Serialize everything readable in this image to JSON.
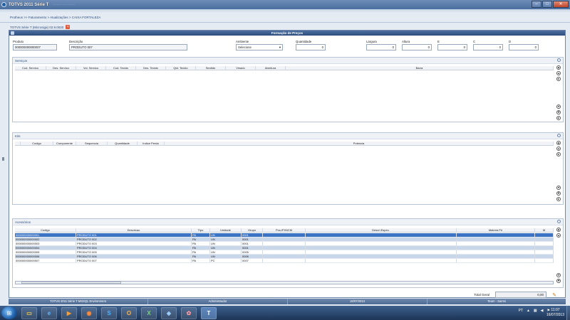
{
  "window": {
    "title": "TOTVS 2011 Série T",
    "blurred_text": "·······  ···········"
  },
  "breadcrumb": "Protheus >> Faturamento > Atualizações > CAIXA FORTALEZA",
  "app_tab": "TOTVS Série T (Microsiga) 02.9.0020",
  "dialog": {
    "title": "Formação de Preços",
    "fields": {
      "produto": {
        "label": "Produto",
        "value": "000000000000007"
      },
      "descricao": {
        "label": "Descrição",
        "value": "PRODUTO 007"
      },
      "ambiente": {
        "label": "Ambiente",
        "value": "Selecione"
      },
      "quantidade": {
        "label": "Quantidade",
        "value": "0"
      },
      "largura": {
        "label": "Largura",
        "value": "0"
      },
      "altura": {
        "label": "Altura",
        "value": "0"
      },
      "e": {
        "label": "E",
        "value": "0"
      },
      "c": {
        "label": "C",
        "value": "0"
      },
      "d": {
        "label": "D",
        "value": "0"
      }
    }
  },
  "servicos": {
    "title": "Serviços",
    "columns": [
      "Cod. Servico",
      "Des. Servico",
      "Vol. Servico",
      "Cod. Tecido",
      "Des. Tecido",
      "Qtd. Tecido",
      "Sentido",
      "Vinado",
      "Abertura",
      "Barra"
    ]
  },
  "kits": {
    "title": "Kits",
    "columns": [
      "",
      "Codigo",
      "Componente",
      "Sequencia",
      "Quantidade",
      "Indice Perda",
      "Potencia"
    ]
  },
  "acessorios": {
    "title": "Acessórios",
    "columns": [
      "Codigo",
      "Descricao",
      "Tipo",
      "Unidade",
      "Grupo",
      "Pos.IPI/NCM",
      "Descri.Espec.",
      "Materia Pri",
      "M"
    ],
    "rows": [
      {
        "codigo": "000000000000001",
        "descricao": "PRODUTO 001",
        "tipo": "PA",
        "unidade": "UN",
        "grupo": "0001"
      },
      {
        "codigo": "000000000000002",
        "descricao": "PRODUTO 002",
        "tipo": "PA",
        "unidade": "UN",
        "grupo": "0001"
      },
      {
        "codigo": "000000000000003",
        "descricao": "PRODUTO 003",
        "tipo": "PA",
        "unidade": "UN",
        "grupo": "0001"
      },
      {
        "codigo": "000000000000004",
        "descricao": "PRODUTO 004",
        "tipo": "PA",
        "unidade": "UN",
        "grupo": "0001"
      },
      {
        "codigo": "000000000000005",
        "descricao": "PRODUTO 005",
        "tipo": "PA",
        "unidade": "UN",
        "grupo": "0005"
      },
      {
        "codigo": "000000000000006",
        "descricao": "PRODUTO 006",
        "tipo": "PA",
        "unidade": "UN",
        "grupo": "0006"
      },
      {
        "codigo": "000000000000007",
        "descricao": "PRODUTO 007",
        "tipo": "PA",
        "unidade": "PC",
        "grupo": "0007"
      }
    ]
  },
  "total": {
    "label": "Total Geral",
    "value": "0,00"
  },
  "statusbar": [
    "TOTVS 2011 Série T  MSSQL Environment",
    "Administrador",
    "16/07/2013",
    "Team - Samsi"
  ],
  "taskbar": {
    "lang": "PT",
    "time": "11:07",
    "date": "16/07/2013"
  }
}
